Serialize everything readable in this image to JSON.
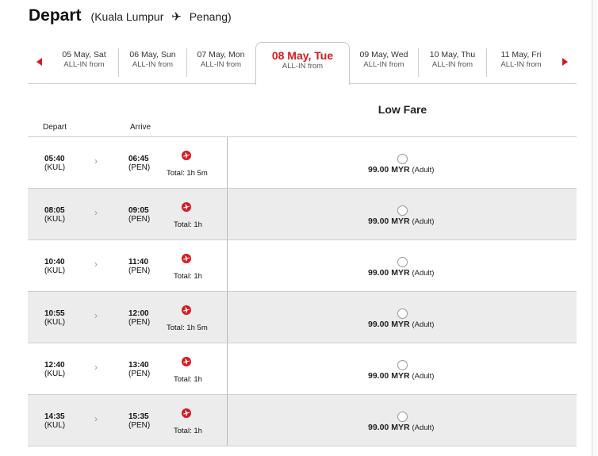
{
  "header": {
    "title": "Depart",
    "route_open": "(Kuala Lumpur",
    "plane_glyph": "✈",
    "route_close": "Penang)"
  },
  "dates": [
    {
      "label": "05 May, Sat",
      "sub": "ALL-IN from"
    },
    {
      "label": "06 May, Sun",
      "sub": "ALL-IN from"
    },
    {
      "label": "07 May, Mon",
      "sub": "ALL-IN from"
    },
    {
      "label": "08 May, Tue",
      "sub": "ALL-IN from",
      "active": true
    },
    {
      "label": "09 May, Wed",
      "sub": "ALL-IN from"
    },
    {
      "label": "10 May, Thu",
      "sub": "ALL-IN from"
    },
    {
      "label": "11 May, Fri",
      "sub": "ALL-IN from"
    }
  ],
  "columns": {
    "depart": "Depart",
    "arrive": "Arrive",
    "fare": "Low Fare"
  },
  "icons": {
    "prev": "chevron-left-icon",
    "next": "chevron-right-icon",
    "row_arrow": "chevron-right-icon",
    "airline": "airasia-icon",
    "select": "radio-icon"
  },
  "colors": {
    "accent": "#d71920",
    "row_shade": "#ececec"
  },
  "flights": [
    {
      "dep_time": "05:40",
      "dep_code": "(KUL)",
      "arr_time": "06:45",
      "arr_code": "(PEN)",
      "total": "Total: 1h 5m",
      "price": "99.00 MYR",
      "pax": "(Adult)"
    },
    {
      "dep_time": "08:05",
      "dep_code": "(KUL)",
      "arr_time": "09:05",
      "arr_code": "(PEN)",
      "total": "Total: 1h",
      "price": "99.00 MYR",
      "pax": "(Adult)"
    },
    {
      "dep_time": "10:40",
      "dep_code": "(KUL)",
      "arr_time": "11:40",
      "arr_code": "(PEN)",
      "total": "Total: 1h",
      "price": "99.00 MYR",
      "pax": "(Adult)"
    },
    {
      "dep_time": "10:55",
      "dep_code": "(KUL)",
      "arr_time": "12:00",
      "arr_code": "(PEN)",
      "total": "Total: 1h 5m",
      "price": "99.00 MYR",
      "pax": "(Adult)"
    },
    {
      "dep_time": "12:40",
      "dep_code": "(KUL)",
      "arr_time": "13:40",
      "arr_code": "(PEN)",
      "total": "Total: 1h",
      "price": "99.00 MYR",
      "pax": "(Adult)"
    },
    {
      "dep_time": "14:35",
      "dep_code": "(KUL)",
      "arr_time": "15:35",
      "arr_code": "(PEN)",
      "total": "Total: 1h",
      "price": "99.00 MYR",
      "pax": "(Adult)"
    }
  ]
}
